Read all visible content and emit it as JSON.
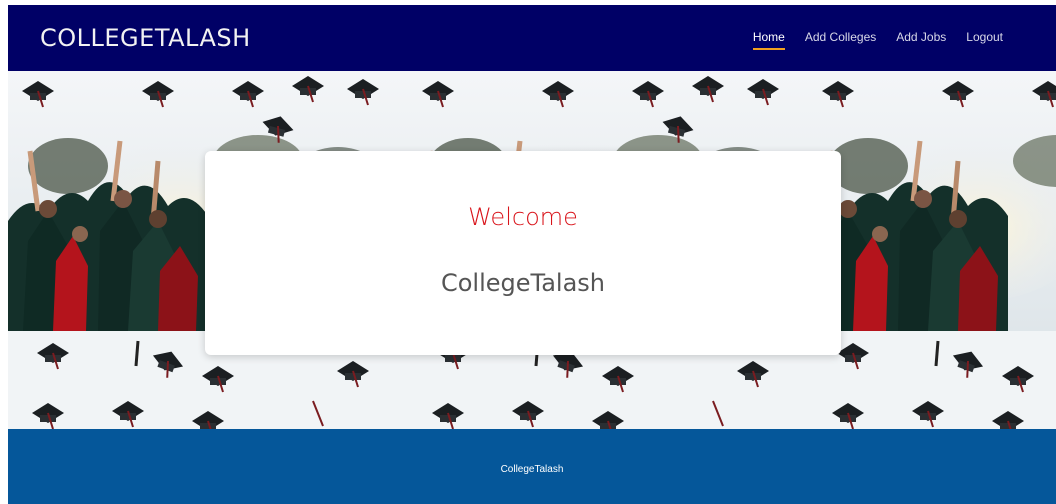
{
  "navbar": {
    "brand": "COLLEGETALASH",
    "items": [
      {
        "label": "Home",
        "active": true
      },
      {
        "label": "Add Colleges",
        "active": false
      },
      {
        "label": "Add Jobs",
        "active": false
      },
      {
        "label": "Logout",
        "active": false
      }
    ]
  },
  "card": {
    "welcome": "Welcome",
    "subtitle": "CollegeTalash"
  },
  "footer": {
    "text": "CollegeTalash"
  },
  "colors": {
    "navbar": "#000066",
    "footer": "#05579a",
    "accent": "#d9141b",
    "active_underline": "#f0a020"
  }
}
